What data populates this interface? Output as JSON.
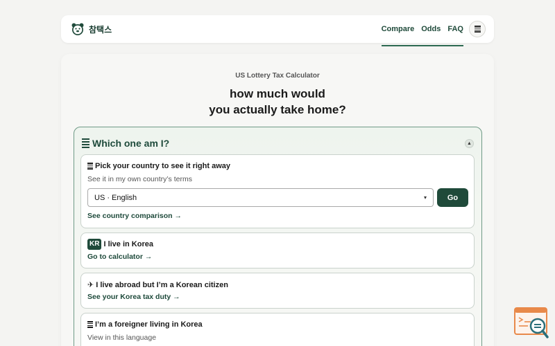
{
  "header": {
    "brand_name": "참택스",
    "nav": [
      "Compare",
      "Odds",
      "FAQ"
    ]
  },
  "hero": {
    "subtitle": "US Lottery Tax Calculator",
    "headline_line1": "how much would",
    "headline_line2": "you actually take home?"
  },
  "panel": {
    "title": "Which one am I?",
    "collapse_glyph": "▲",
    "options": [
      {
        "title": "Pick your country to see it right away",
        "desc": "See it in my own country’s terms",
        "select_value": "US · English",
        "button": "Go",
        "link": "See country comparison →"
      },
      {
        "badge": "KR",
        "title": "I live in Korea",
        "link": "Go to calculator →"
      },
      {
        "icon_glyph": "✈",
        "title": "I live abroad but I’m a Korean citizen",
        "link": "See your Korea tax duty →"
      },
      {
        "title": "I’m a foreigner living in Korea",
        "desc": "View in this language"
      }
    ]
  },
  "colors": {
    "brand": "#1f4a3a",
    "accent_border": "#6f9a86",
    "widget_orange": "#e8894a",
    "widget_teal": "#2b6f7a"
  },
  "icons": {
    "logo": "bear-face-icon",
    "menu": "hamburger-icon",
    "panel": "list-bars-icon",
    "plane": "airplane-icon",
    "widget": "code-search-icon"
  }
}
